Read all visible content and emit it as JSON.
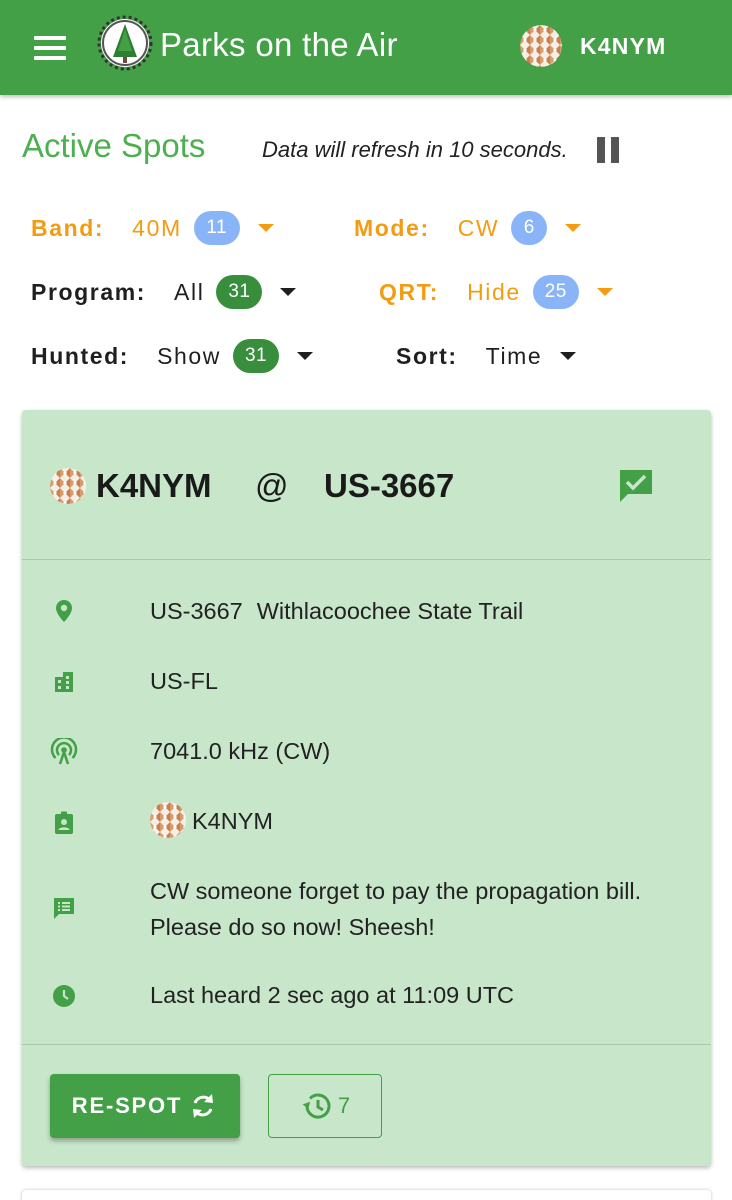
{
  "app": {
    "title": "Parks on the Air",
    "user_callsign": "K4NYM"
  },
  "header": {
    "title": "Active Spots",
    "refresh_text": "Data will refresh in 10 seconds."
  },
  "filters": {
    "band": {
      "label": "Band:",
      "value": "40M",
      "count": "11"
    },
    "mode": {
      "label": "Mode:",
      "value": "CW",
      "count": "6"
    },
    "program": {
      "label": "Program:",
      "value": "All",
      "count": "31"
    },
    "qrt": {
      "label": "QRT:",
      "value": "Hide",
      "count": "25"
    },
    "hunted": {
      "label": "Hunted:",
      "value": "Show",
      "count": "31"
    },
    "sort": {
      "label": "Sort:",
      "value": "Time"
    }
  },
  "spot": {
    "activator": "K4NYM",
    "at": "@",
    "park_ref": "US-3667",
    "park_name": "Withlacoochee State Trail",
    "location": "US-FL",
    "frequency": "7041.0 kHz (CW)",
    "spotter": "K4NYM",
    "comment": "CW someone forget to pay the propagation bill. Please do so now! Sheesh!",
    "last_heard": "Last heard 2 sec ago at 11:09 UTC",
    "respot_label": "RE-SPOT",
    "history_count": "7"
  },
  "colors": {
    "primary": "#43a047",
    "accent_orange": "#f39c12",
    "card_bg": "#c8e6c9",
    "badge_blue": "#8ab4f8",
    "badge_green": "#388e3c"
  },
  "icons": {
    "menu": "menu-icon",
    "pause": "pause-icon",
    "hunted": "chat-check-icon",
    "park": "map-pin-icon",
    "location": "city-icon",
    "frequency": "antenna-icon",
    "spotter": "badge-account-icon",
    "comment": "comment-text-icon",
    "time": "clock-icon",
    "respot": "refresh-icon",
    "history": "history-icon"
  }
}
